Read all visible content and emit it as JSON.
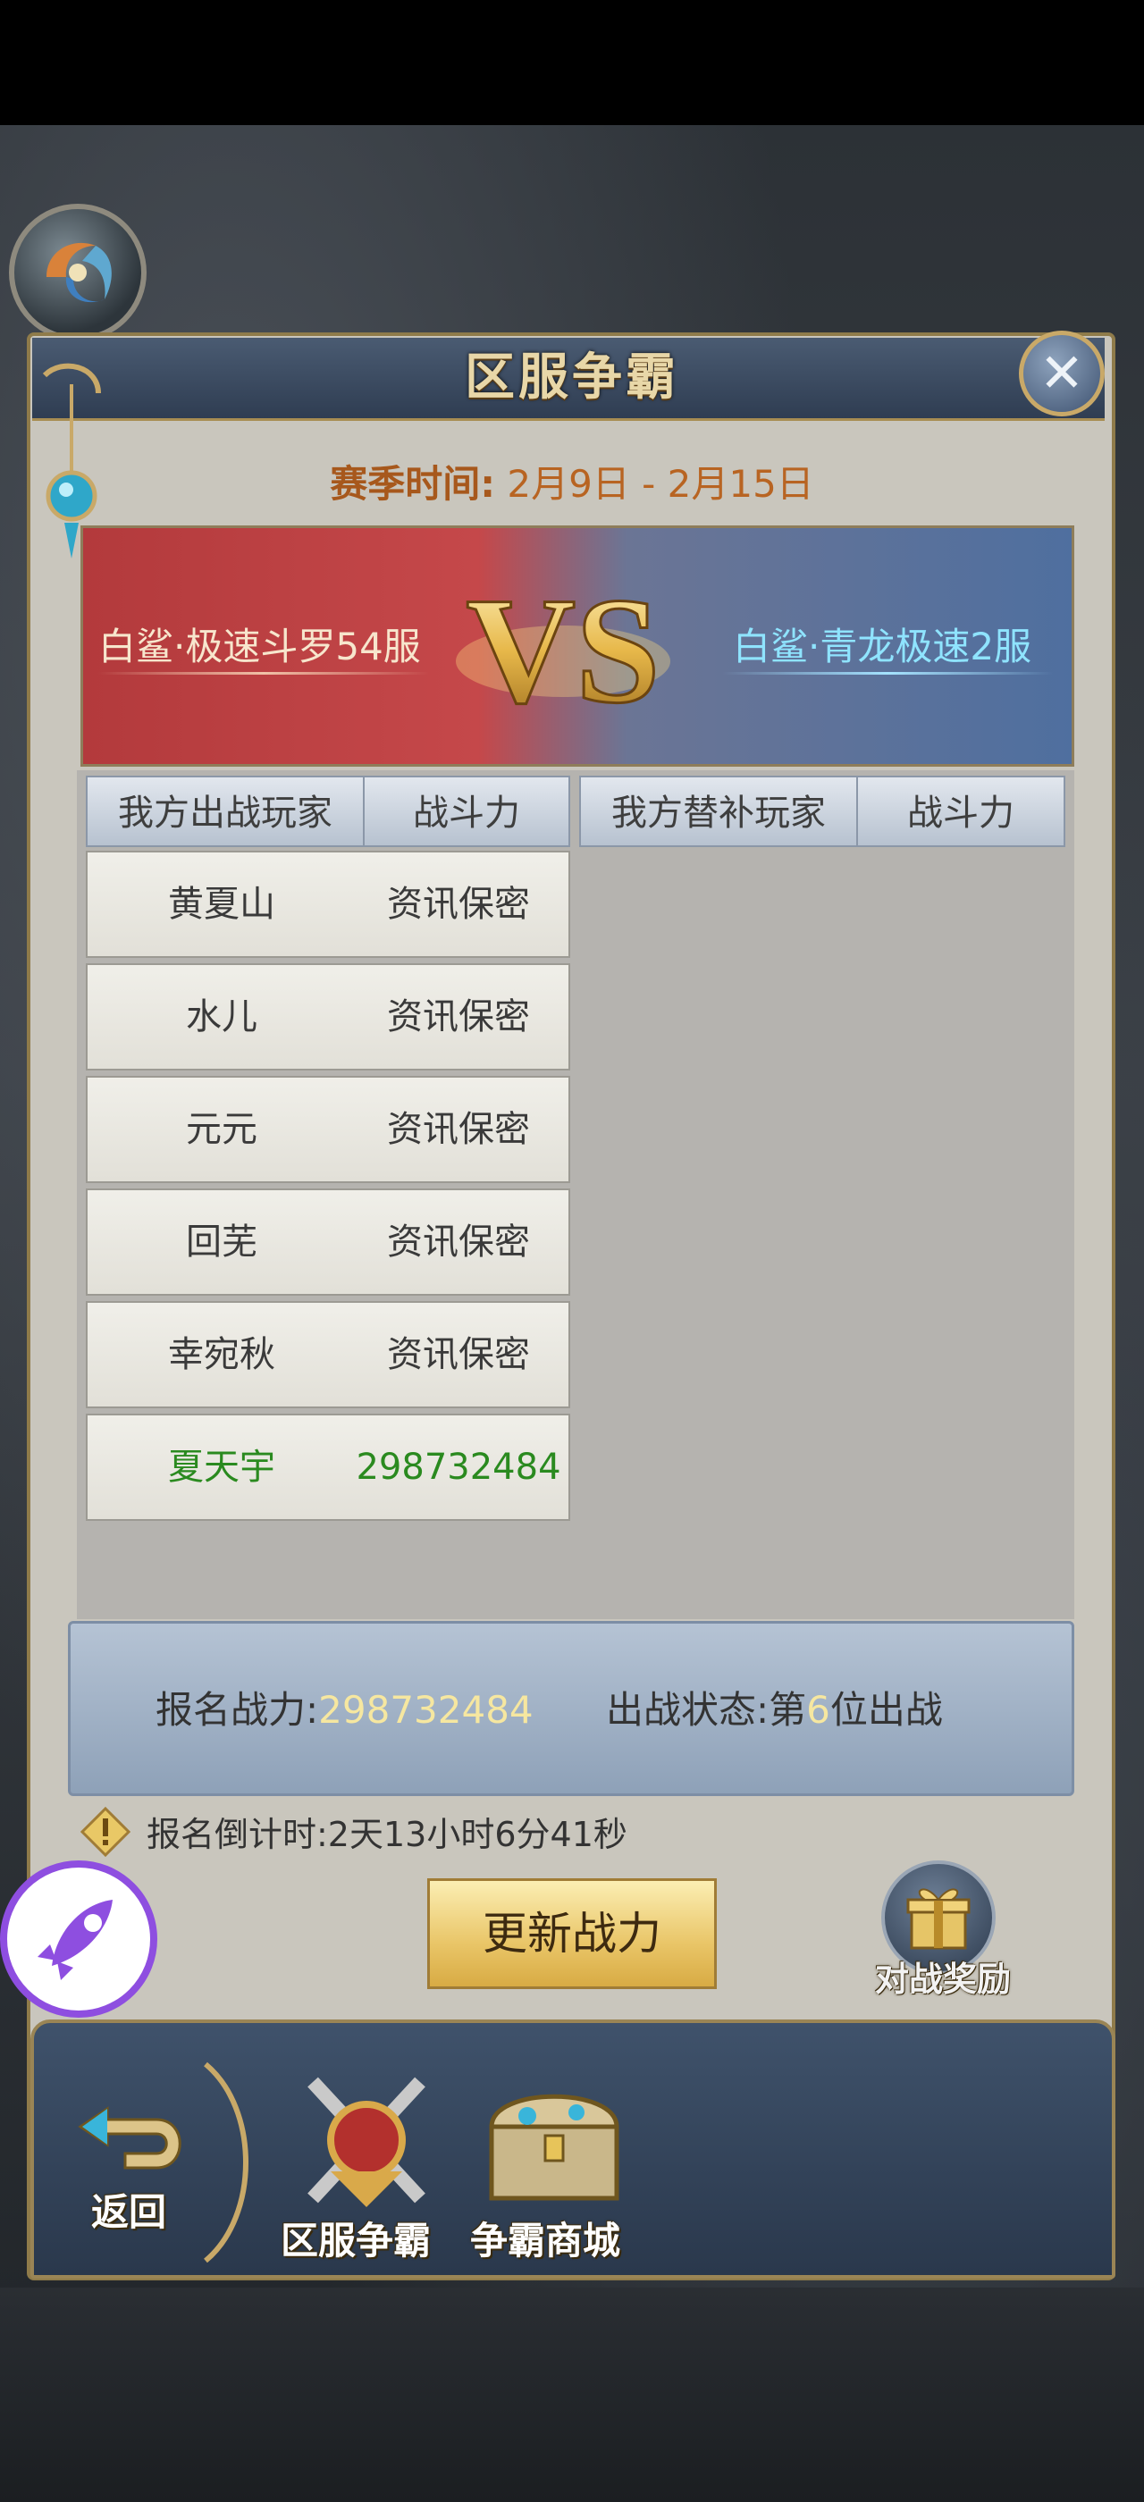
{
  "header": {
    "title": "区服争霸",
    "close_icon": "close-icon"
  },
  "season": {
    "label": "赛季时间:",
    "value": "2月9日 - 2月15日"
  },
  "matchup": {
    "left_server": "白鲨·极速斗罗54服",
    "vs_text": "VS",
    "right_server": "白鲨·青龙极速2服"
  },
  "table_headers": {
    "my_players": "我方出战玩家",
    "power": "战斗力",
    "substitutes": "我方替补玩家",
    "sub_power": "战斗力"
  },
  "players": [
    {
      "name": "黄夏山",
      "power": "资讯保密"
    },
    {
      "name": "水儿",
      "power": "资讯保密"
    },
    {
      "name": "元元",
      "power": "资讯保密"
    },
    {
      "name": "回芜",
      "power": "资讯保密"
    },
    {
      "name": "幸宛秋",
      "power": "资讯保密"
    },
    {
      "name": "夏天宇",
      "power": "298732484"
    }
  ],
  "status": {
    "signup_power_label": "报名战力:",
    "signup_power_value": "298732484",
    "battle_status_label": "出战状态:第",
    "battle_status_rank": "6",
    "battle_status_suffix": "位出战"
  },
  "countdown": "报名倒计时:2天13小时6分41秒",
  "buttons": {
    "update_power": "更新战力",
    "battle_reward": "对战奖励"
  },
  "nav": [
    {
      "label": "返回"
    },
    {
      "label": "区服争霸"
    },
    {
      "label": "争霸商城"
    }
  ],
  "colors": {
    "highlight_green": "#2a8a1f",
    "highlight_yellow": "#f6e7a0",
    "accent_gold": "#a88d52"
  }
}
